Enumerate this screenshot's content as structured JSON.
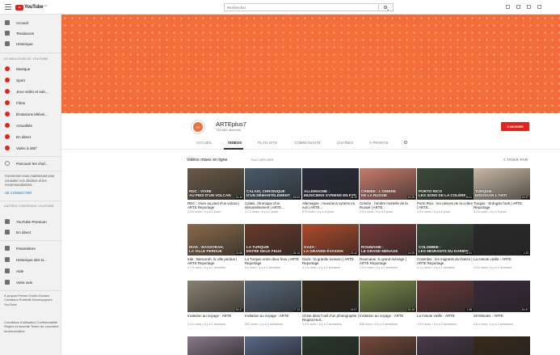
{
  "topbar": {
    "logo_text": "YouTube",
    "logo_region": "FR",
    "search_placeholder": "Rechercher"
  },
  "sidebar": {
    "main": [
      {
        "label": "Accueil",
        "icon": "home-icon"
      },
      {
        "label": "Tendances",
        "icon": "flame-icon"
      },
      {
        "label": "Historique",
        "icon": "history-icon"
      }
    ],
    "best_heading": "LE MEILLEUR DE YOUTUBE",
    "best": [
      {
        "label": "Musique"
      },
      {
        "label": "Sport"
      },
      {
        "label": "Jeux vidéo et sub..."
      },
      {
        "label": "Films"
      },
      {
        "label": "Émissions télévis..."
      },
      {
        "label": "Actualités"
      },
      {
        "label": "En direct"
      },
      {
        "label": "Vidéo à 360°"
      }
    ],
    "browse_channels": "Parcourir les chaî...",
    "signin_text": "Connectez-vous maintenant pour consulter vos chaînes et les recommandations.",
    "signin_link": "SE CONNECTER",
    "more_heading": "AUTRES CONTENUS YOUTUBE",
    "more": [
      {
        "label": "YouTube Premium"
      },
      {
        "label": "En direct"
      }
    ],
    "settings": [
      {
        "label": "Paramètres",
        "icon": "gear-icon"
      },
      {
        "label": "Historique des si...",
        "icon": "flag-icon"
      },
      {
        "label": "Aide",
        "icon": "help-icon"
      },
      {
        "label": "Votre avis",
        "icon": "feedback-icon"
      }
    ],
    "footer1": "À propos  Presse  Droits d'auteur  Créateurs  Publicité  Développeurs  YouTube",
    "footer2": "Conditions d'utilisation  Confidentialité  Règles et sécurité  Tester de nouvelles fonctionnalités"
  },
  "banner": {
    "color": "#f36d3a"
  },
  "channel": {
    "avatar_text": "+7",
    "name": "ARTEplus7",
    "subscribers": "768 884 abonnés",
    "subscribe_label": "S'ABONNER",
    "tabs": [
      "ACCUEIL",
      "VIDÉOS",
      "PLAYLISTS",
      "COMMUNAUTÉ",
      "CHAÎNES",
      "À PROPOS"
    ]
  },
  "videos_section": {
    "title": "Vidéos mises en ligne",
    "dropdown": "TOUT AFFICHER",
    "sort_label": "TRIER PAR"
  },
  "videos": [
    {
      "cap1": "RDC : VIVRE",
      "cap2": "AU PIED D'UN VOLCAN",
      "title": "RDC : Vivre au pied d'un volcan | ARTE Reportage",
      "meta": "2,3 k vues • il y a 2 jours",
      "color": "#6b5a48",
      "dur": "24:44"
    },
    {
      "cap1": "CALAIS, CHRONIQUE",
      "cap2": "D'UN DÉMANTÈLEMENT",
      "title": "Calais, chronique d'un démantèlement | ARTE...",
      "meta": "1,7 k vues • il y a 3 jours",
      "color": "#4a5a6a",
      "dur": "26:03"
    },
    {
      "cap1": "ALLEMAGNE :",
      "cap2": "MUSICIENS SYRIENS EN EXIL",
      "title": "Allemagne : musiciens syriens en exil | ARTE...",
      "meta": "670 vues • il y a 4 jours",
      "color": "#2c2c3c",
      "dur": "24:10"
    },
    {
      "cap1": "CRIMÉE : L'OMBRE",
      "cap2": "DE LA RUSSIE",
      "title": "Crimée : l'ombre mortelle de la Russie | ARTE...",
      "meta": "2,5 k vues • il y a 5 jours",
      "color": "#c87b6a",
      "dur": "24:25"
    },
    {
      "cap1": "PORTO RICO",
      "cap2": "LES SONS DE LA COLÈRE",
      "title": "Porto Rico : les raisons de la colère | ARTE...",
      "meta": "1,5 k vues • il y a 6 jours",
      "color": "#3c4a3a",
      "dur": "26:11"
    },
    {
      "cap1": "TURQUIE :",
      "cap2": "ERDOGAN L'ANTI",
      "title": "Turquie : Erdogan l'anti | ARTE Reportage",
      "meta": "3,4 k vues • il y a 6 jours",
      "color": "#c9b8a4",
      "dur": "24:37"
    },
    {
      "cap1": "IRAK : BASSORAH,",
      "cap2": "LA VILLE PERDUE",
      "title": "Irak : Bassorah, la ville perdue | ARTE Reportage",
      "meta": "2,7 k vues • il y a 1 semaine",
      "color": "#8a6a4a",
      "dur": "24:58"
    },
    {
      "cap1": "LA TURQUIE",
      "cap2": "ENTRE DEUX FEUX",
      "title": "La Turquie entre deux feux | ARTE Reportage",
      "meta": "5 k vues • il y a 1 semaine",
      "color": "#6a3a2a",
      "dur": "25:15"
    },
    {
      "cap1": "GAZA :",
      "cap2": "LA GRANDE ÉVASION",
      "title": "Gaza : la grande évasion | ARTE Reportage",
      "meta": "4,2 k vues • il y a 1 semaine",
      "color": "#b04a2a",
      "dur": "23:42"
    },
    {
      "cap1": "ROUMANIE :",
      "cap2": "LE GRAND MÉNAGE",
      "title": "Roumanie, le grand ménage | ARTE Reportage",
      "meta": "2,5 k vues • il y a 1 semaine",
      "color": "#7a3a3a",
      "dur": "24:29"
    },
    {
      "cap1": "COLOMBIE :",
      "cap2": "LES MIGRANTS DU DARIEN",
      "title": "Colombie : les migrants du Darien | ARTE Reportage",
      "meta": "3,1 k vues • il y a 1 semaine",
      "color": "#3a4a3a",
      "dur": "25:01"
    },
    {
      "cap1": "",
      "cap2": "",
      "title": "La minute vieille - ARTE",
      "meta": "1,5 k vues • il y a 1 semaine",
      "color": "#2a2a2a",
      "dur": "1:33"
    },
    {
      "cap1": "",
      "cap2": "",
      "title": "Invitation au voyage - ARTE",
      "meta": "2,4 k vues • il y a 1 semaine",
      "color": "#8a8070",
      "dur": "26:47"
    },
    {
      "cap1": "",
      "cap2": "",
      "title": "Invitation au voyage - ARTE",
      "meta": "532 vues • il y a 2 semaines",
      "color": "#5a6a7a",
      "dur": "27:13"
    },
    {
      "cap1": "",
      "cap2": "",
      "title": "Chine dans l'oeil d'un photographe | Regina Heil...",
      "meta": "2,4 k vues • il y a 2 semaines",
      "color": "#3a2a1a",
      "dur": "13:07"
    },
    {
      "cap1": "",
      "cap2": "",
      "title": "Invitation au voyage - ARTE",
      "meta": "636 vues • il y a 2 semaines",
      "color": "#7a8a4a",
      "dur": "26:48"
    },
    {
      "cap1": "",
      "cap2": "",
      "title": "La minute vieille - ARTE",
      "meta": "1,9 k vues • il y a 2 semaines",
      "color": "#6a3a3a",
      "dur": "1:35"
    },
    {
      "cap1": "",
      "cap2": "",
      "title": "28 Minutes - ARTE",
      "meta": "2,8 k vues • il y a 2 semaines",
      "color": "#3a2a3a",
      "dur": "43:47"
    }
  ],
  "partial_row": [
    {
      "color": "#8a7a8a"
    },
    {
      "color": "#5a6a8a"
    },
    {
      "color": "#2a3a2a"
    },
    {
      "color": "#7a4a3a"
    },
    {
      "color": "#4a3a4a"
    },
    {
      "color": "#3a2a1a"
    }
  ]
}
